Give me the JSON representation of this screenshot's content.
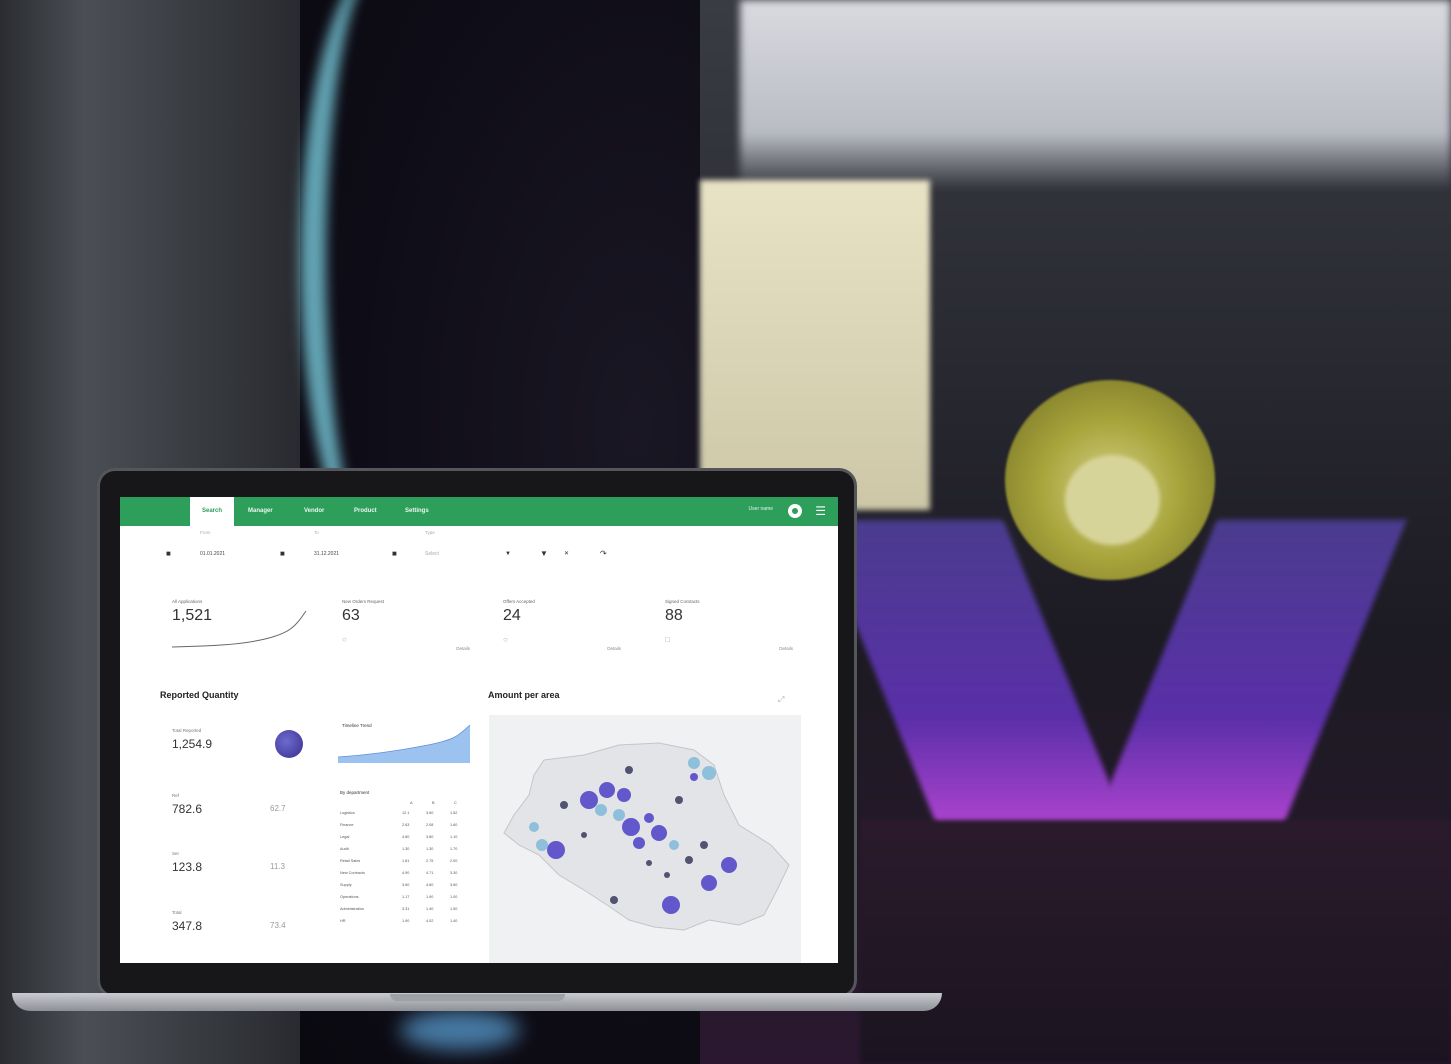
{
  "nav": {
    "tabs": [
      {
        "label": "Search",
        "active": true
      },
      {
        "label": "Manager"
      },
      {
        "label": "Vendor"
      },
      {
        "label": "Product"
      },
      {
        "label": "Settings"
      }
    ],
    "user_name": "User name"
  },
  "filters": {
    "from_label": "From",
    "from_value": "01.01.2021",
    "to_label": "To",
    "to_value": "31.12.2021",
    "type_label": "Type",
    "type_placeholder": "Select"
  },
  "kpis": [
    {
      "label": "All Applications",
      "value": "1,521"
    },
    {
      "label": "New Orders Request",
      "value": "63",
      "link": "Details"
    },
    {
      "label": "Offers Accepted",
      "value": "24",
      "link": "Details"
    },
    {
      "label": "Signed Contracts",
      "value": "88",
      "link": "Details"
    }
  ],
  "reported_quantity": {
    "title": "Reported Quantity",
    "total_label": "Total Reported",
    "total_value": "1,254.9",
    "items": [
      {
        "label": "Ref",
        "value": "782.6",
        "percent": "62.7"
      },
      {
        "label": "Ser",
        "value": "123.8",
        "percent": "11.3"
      },
      {
        "label": "Total",
        "value": "347.8",
        "percent": "73.4"
      }
    ],
    "timeline_title": "Timeline Trend",
    "breakdown_title": "By department",
    "breakdown_headers": [
      "",
      "A",
      "B",
      "C"
    ],
    "breakdown_rows": [
      [
        "Logistics",
        "12.1",
        "3.60",
        "1.52"
      ],
      [
        "Finance",
        "2.63",
        "2.08",
        "1.60"
      ],
      [
        "Legal",
        "4.80",
        "3.80",
        "1.10"
      ],
      [
        "Audit",
        "1.30",
        "1.30",
        "1.70"
      ],
      [
        "Retail Sales",
        "1.81",
        "2.75",
        "2.00"
      ],
      [
        "New Contracts",
        "4.90",
        "4.71",
        "3.30"
      ],
      [
        "Supply",
        "3.60",
        "4.60",
        "3.60"
      ],
      [
        "Operations",
        "1.17",
        "1.90",
        "1.00"
      ],
      [
        "Administration",
        "3.31",
        "1.40",
        "1.50"
      ],
      [
        "HR",
        "1.90",
        "4.02",
        "1.40"
      ]
    ]
  },
  "map": {
    "title": "Amount per area",
    "colors": {
      "primary": "#5b4fc9",
      "secondary": "#7fb8d8",
      "small": "#4a4a6a"
    }
  },
  "colors": {
    "brand": "#2e9e5b",
    "accent": "#5b4fc9",
    "area": "#6f9fe0"
  }
}
